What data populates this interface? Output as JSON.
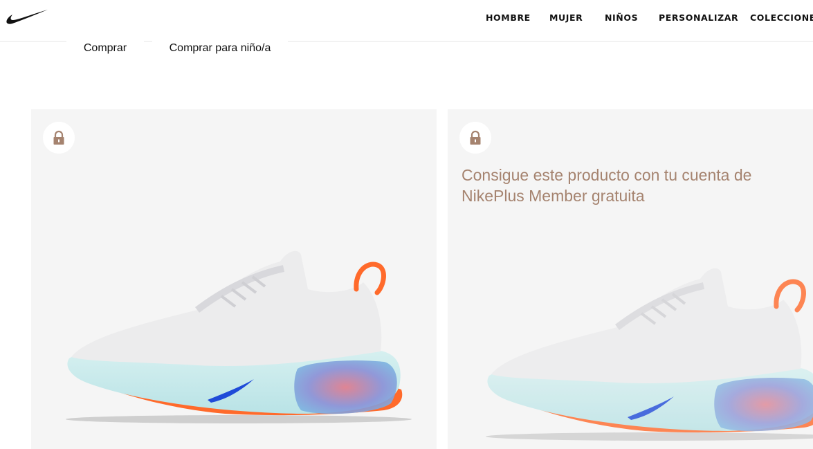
{
  "header": {
    "logo": "nike-swoosh-logo",
    "nav": [
      "HOMBRE",
      "MUJER",
      "NIÑOS",
      "PERSONALIZAR",
      "COLECCIONES"
    ]
  },
  "subnav": {
    "tabs": [
      "Comprar",
      "Comprar para niño/a"
    ]
  },
  "products": [
    {
      "locked": true,
      "icon": "lock-icon",
      "image": "sneaker-image"
    },
    {
      "locked": true,
      "icon": "lock-icon",
      "image": "sneaker-image",
      "message": "Consigue este producto con tu cuenta de NikePlus Member gratuita"
    }
  ],
  "colors": {
    "accent_brown": "#a5836f",
    "card_bg": "#f5f5f5"
  }
}
